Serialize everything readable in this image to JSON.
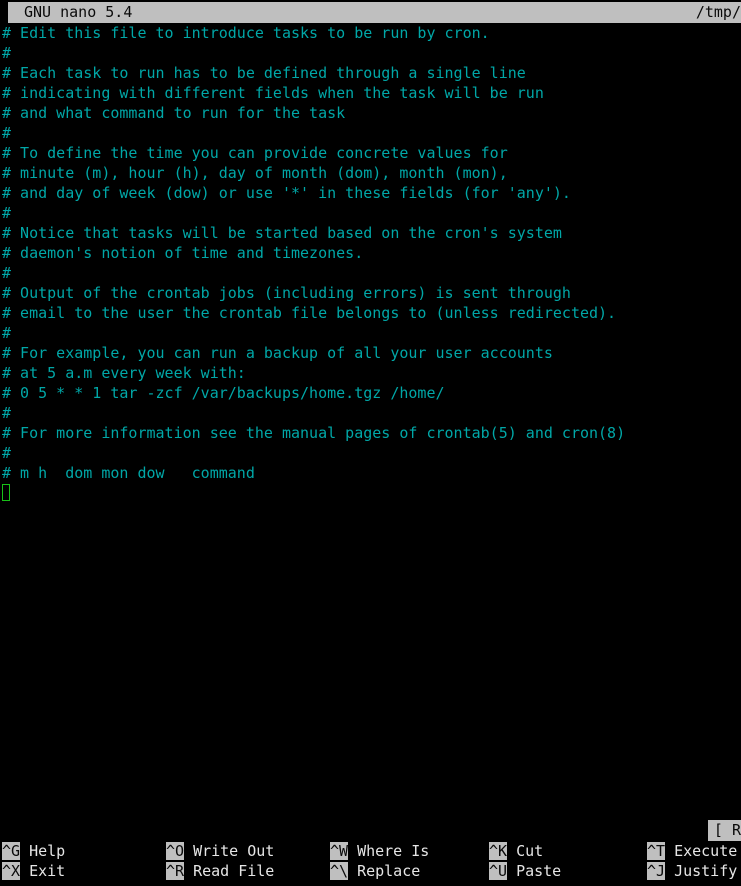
{
  "titlebar": {
    "version": "GNU nano 5.4",
    "filename": "/tmp/"
  },
  "editor": {
    "lines": [
      "# Edit this file to introduce tasks to be run by cron.",
      "#",
      "# Each task to run has to be defined through a single line",
      "# indicating with different fields when the task will be run",
      "# and what command to run for the task",
      "#",
      "# To define the time you can provide concrete values for",
      "# minute (m), hour (h), day of month (dom), month (mon),",
      "# and day of week (dow) or use '*' in these fields (for 'any').",
      "#",
      "# Notice that tasks will be started based on the cron's system",
      "# daemon's notion of time and timezones.",
      "#",
      "# Output of the crontab jobs (including errors) is sent through",
      "# email to the user the crontab file belongs to (unless redirected).",
      "#",
      "# For example, you can run a backup of all your user accounts",
      "# at 5 a.m every week with:",
      "# 0 5 * * 1 tar -zcf /var/backups/home.tgz /home/",
      "#",
      "# For more information see the manual pages of crontab(5) and cron(8)",
      "#",
      "# m h  dom mon dow   command"
    ],
    "cursor_line_index": 23,
    "text_color": "#00a7a7",
    "cursor_color": "#18c018"
  },
  "status": {
    "message": "[ R"
  },
  "shortcuts": {
    "row1": [
      {
        "key": "^G",
        "desc": "Help"
      },
      {
        "key": "^O",
        "desc": "Write Out"
      },
      {
        "key": "^W",
        "desc": "Where Is"
      },
      {
        "key": "^K",
        "desc": "Cut"
      },
      {
        "key": "^T",
        "desc": "Execute"
      }
    ],
    "row2": [
      {
        "key": "^X",
        "desc": "Exit"
      },
      {
        "key": "^R",
        "desc": "Read File"
      },
      {
        "key": "^\\",
        "desc": "Replace"
      },
      {
        "key": "^U",
        "desc": "Paste"
      },
      {
        "key": "^J",
        "desc": "Justify"
      }
    ]
  }
}
